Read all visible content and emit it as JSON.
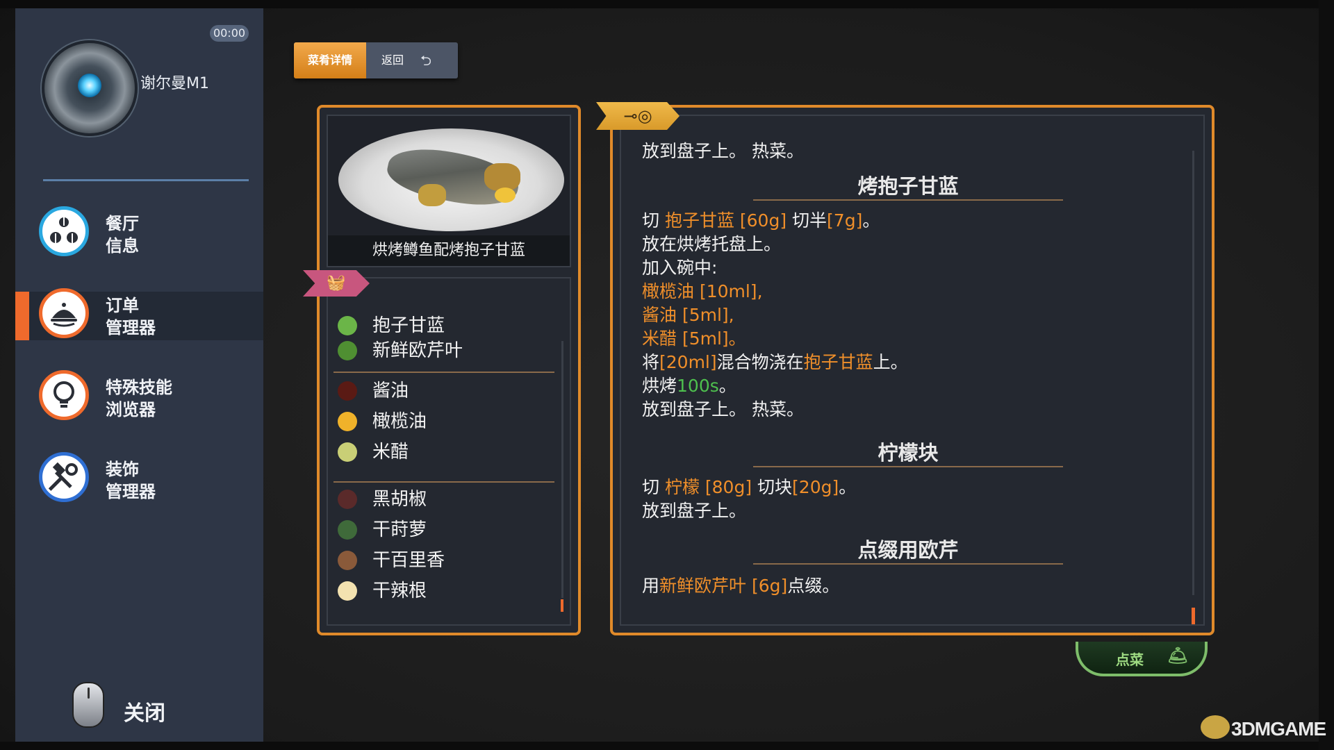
{
  "sidebar": {
    "timer": "00:00",
    "username": "谢尔曼M1",
    "nav": [
      {
        "line1": "餐厅",
        "line2": "信息",
        "icon": "restaurant-info-icon",
        "active": false
      },
      {
        "line1": "订单",
        "line2": "管理器",
        "icon": "cloche-icon",
        "active": true
      },
      {
        "line1": "特殊技能",
        "line2": "浏览器",
        "icon": "lightbulb-icon",
        "active": false
      },
      {
        "line1": "装饰",
        "line2": "管理器",
        "icon": "hammer-wrench-icon",
        "active": false
      }
    ],
    "close_label": "关闭"
  },
  "tabs": {
    "details_label": "菜肴详情",
    "back_label": "返回"
  },
  "dish": {
    "name": "烘烤鳟鱼配烤抱子甘蓝"
  },
  "ingredients": {
    "group1": [
      {
        "name": "抱子甘蓝",
        "color": "#6bb548"
      },
      {
        "name": "新鲜欧芹叶",
        "color": "#4f8f32"
      }
    ],
    "group2": [
      {
        "name": "酱油",
        "color": "#5a1a14"
      },
      {
        "name": "橄榄油",
        "color": "#f0b22a"
      },
      {
        "name": "米醋",
        "color": "#c9cf76"
      }
    ],
    "group3": [
      {
        "name": "黑胡椒",
        "color": "#5a2a2a"
      },
      {
        "name": "干莳萝",
        "color": "#3f6a3a"
      },
      {
        "name": "干百里香",
        "color": "#8a5a3a"
      },
      {
        "name": "干辣根",
        "color": "#f3e2b0"
      }
    ]
  },
  "recipe": {
    "top_line_a": "放到盘子上。",
    "top_line_b": "热菜。",
    "section1": {
      "title": "烤抱子甘蓝",
      "l1_pre": "切 ",
      "l1_hl": "抱子甘蓝 [60g]",
      "l1_mid": " 切半",
      "l1_hl2": "[7g]",
      "l1_end": "。",
      "l2": "放在烘烤托盘上。",
      "l3": "加入碗中:",
      "l4": " 橄榄油 [10ml],",
      "l5": " 酱油 [5ml],",
      "l6": " 米醋 [5ml]。",
      "l7_pre": "将",
      "l7_hl": "[20ml]",
      "l7_mid": "混合物浇在",
      "l7_hl2": "抱子甘蓝",
      "l7_end": "上。",
      "l8_pre": "烘烤",
      "l8_hl": "100s",
      "l8_end": "。",
      "l9a": "放到盘子上。",
      "l9b": "热菜。"
    },
    "section2": {
      "title": "柠檬块",
      "l1_pre": "切 ",
      "l1_hl": "柠檬 [80g]",
      "l1_mid": " 切块",
      "l1_hl2": "[20g]",
      "l1_end": "。",
      "l2": "放到盘子上。"
    },
    "section3": {
      "title": "点缀用欧芹",
      "l1_pre": "用",
      "l1_hl": "新鲜欧芹叶 [6g]",
      "l1_end": "点缀。"
    }
  },
  "order_button": {
    "label": "点菜"
  },
  "watermark": {
    "text": "3DMGAME"
  }
}
